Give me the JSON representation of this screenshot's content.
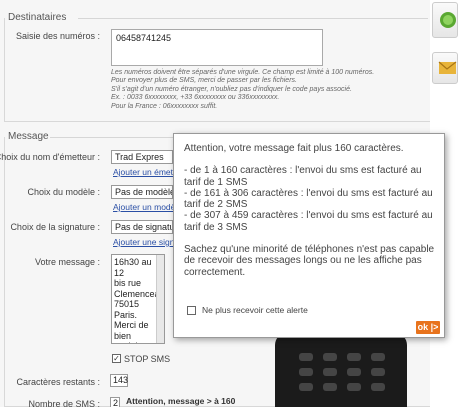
{
  "destinataires": {
    "title": "Destinataires",
    "numbers_label": "Saisie des numéros :",
    "numbers_value": "06458741245",
    "help_lines": [
      "Les numéros doivent être séparés d'une virgule. Ce champ est limité à 100 numéros.",
      "Pour envoyer plus de SMS, merci de passer par les fichiers.",
      "S'il s'agit d'un numéro étranger, n'oubliez pas d'indiquer le code pays associé.",
      "Ex. : 0033 6xxxxxxxx, +33 6xxxxxxxx ou 336xxxxxxxx.",
      "Pour la France : 06xxxxxxxx suffit."
    ]
  },
  "message": {
    "title": "Message",
    "sender_label": "Choix du nom d'émetteur :",
    "sender_value": "Trad Expres",
    "sender_link": "Ajouter un émet",
    "model_label": "Choix du modèle :",
    "model_value": "Pas de modèle",
    "model_link": "Ajouter un modè",
    "signature_label": "Choix de la signature :",
    "signature_value": "Pas de signatur",
    "signature_link": "Ajouter une signa",
    "text_label": "Votre message :",
    "text_value": "16h30 au 12\nbis rue\nClemenceau,\n75015 Paris.\nMerci de bien\nvouloir\nconfirmer par\ntél",
    "stop_sms_label": "STOP SMS",
    "stop_sms_checked": "✓",
    "remaining_label": "Caractères restants :",
    "remaining_value": "143",
    "nb_sms_label": "Nombre de SMS :",
    "nb_sms_value": "2",
    "warning": "Attention, message > à 160"
  },
  "popup": {
    "intro": "Attention, votre message fait plus 160 caractères.",
    "ranges": "- de 1 à 160 caractères : l'envoi du sms est facturé au tarif de 1 SMS\n- de 161 à 306 caractères : l'envoi du sms est facturé au tarif de 2 SMS\n- de 307 à 459 caractères : l'envoi du sms est facturé au tarif de 3 SMS",
    "note": "Sachez qu'une minorité de téléphones n'est pas capable de recevoir des messages longs ou ne les affiche pas correctement.",
    "checkbox_label": "Ne plus recevoir cette alerte",
    "ok_label": "ok |>"
  },
  "colors": {
    "accent": "#e8731c",
    "link": "#2a4fa5"
  }
}
